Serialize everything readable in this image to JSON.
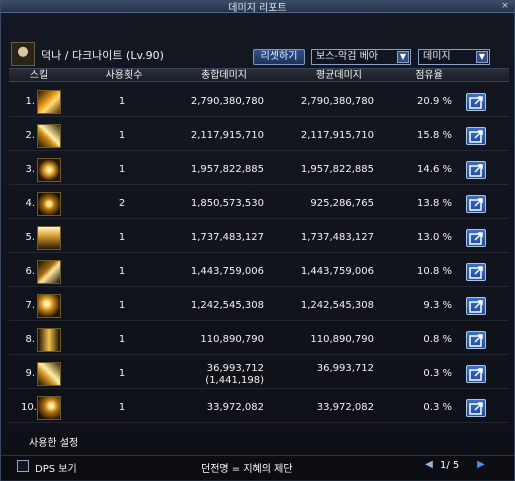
{
  "window": {
    "title": "데미지 리포트"
  },
  "header": {
    "character": "덕나 / 다크나이트 (Lv.90)",
    "reset_label": "리셋하기",
    "target_select": "보스-악검 베아",
    "metric_select": "데미지"
  },
  "table": {
    "headers": {
      "skill": "스킬",
      "count": "사용횟수",
      "total": "총합데미지",
      "avg": "평균데미지",
      "share": "점유율"
    },
    "rows": [
      {
        "rank": "1.",
        "count": "1",
        "total": "2,790,380,780",
        "avg": "2,790,380,780",
        "share": "20.9 %",
        "icon": "fire-slash-icon"
      },
      {
        "rank": "2.",
        "count": "1",
        "total": "2,117,915,710",
        "avg": "2,117,915,710",
        "share": "15.8 %",
        "icon": "lightning-slash-icon"
      },
      {
        "rank": "3.",
        "count": "1",
        "total": "1,957,822,885",
        "avg": "1,957,822,885",
        "share": "14.6 %",
        "icon": "claw-slash-icon"
      },
      {
        "rank": "4.",
        "count": "2",
        "total": "1,850,573,530",
        "avg": "925,286,765",
        "share": "13.8 %",
        "icon": "vortex-icon"
      },
      {
        "rank": "5.",
        "count": "1",
        "total": "1,737,483,127",
        "avg": "1,737,483,127",
        "share": "13.0 %",
        "icon": "sword-rise-icon"
      },
      {
        "rank": "6.",
        "count": "1",
        "total": "1,443,759,006",
        "avg": "1,443,759,006",
        "share": "10.8 %",
        "icon": "sword-thrust-icon"
      },
      {
        "rank": "7.",
        "count": "1",
        "total": "1,242,545,308",
        "avg": "1,242,545,308",
        "share": "9.3 %",
        "icon": "spark-burst-icon"
      },
      {
        "rank": "8.",
        "count": "1",
        "total": "110,890,790",
        "avg": "110,890,790",
        "share": "0.8 %",
        "icon": "wave-slash-icon"
      },
      {
        "rank": "9.",
        "count": "1",
        "total": "36,993,712",
        "total_sub": "(1,441,198)",
        "avg": "36,993,712",
        "share": "0.3 %",
        "icon": "dragon-slash-icon"
      },
      {
        "rank": "10.",
        "count": "1",
        "total": "33,972,082",
        "avg": "33,972,082",
        "share": "0.3 %",
        "icon": "crescent-slash-icon"
      }
    ]
  },
  "footer": {
    "settings_label": "사용한 설정",
    "dps_label": "DPS 보기",
    "dungeon": "던전명 = 지혜의 제단",
    "page": "1/ 5"
  },
  "colors": {
    "titlebar": "#2f3e58",
    "button_blue": "#2b4f8f",
    "share_button": "#3b6fc3",
    "text": "#f3f3f3"
  }
}
